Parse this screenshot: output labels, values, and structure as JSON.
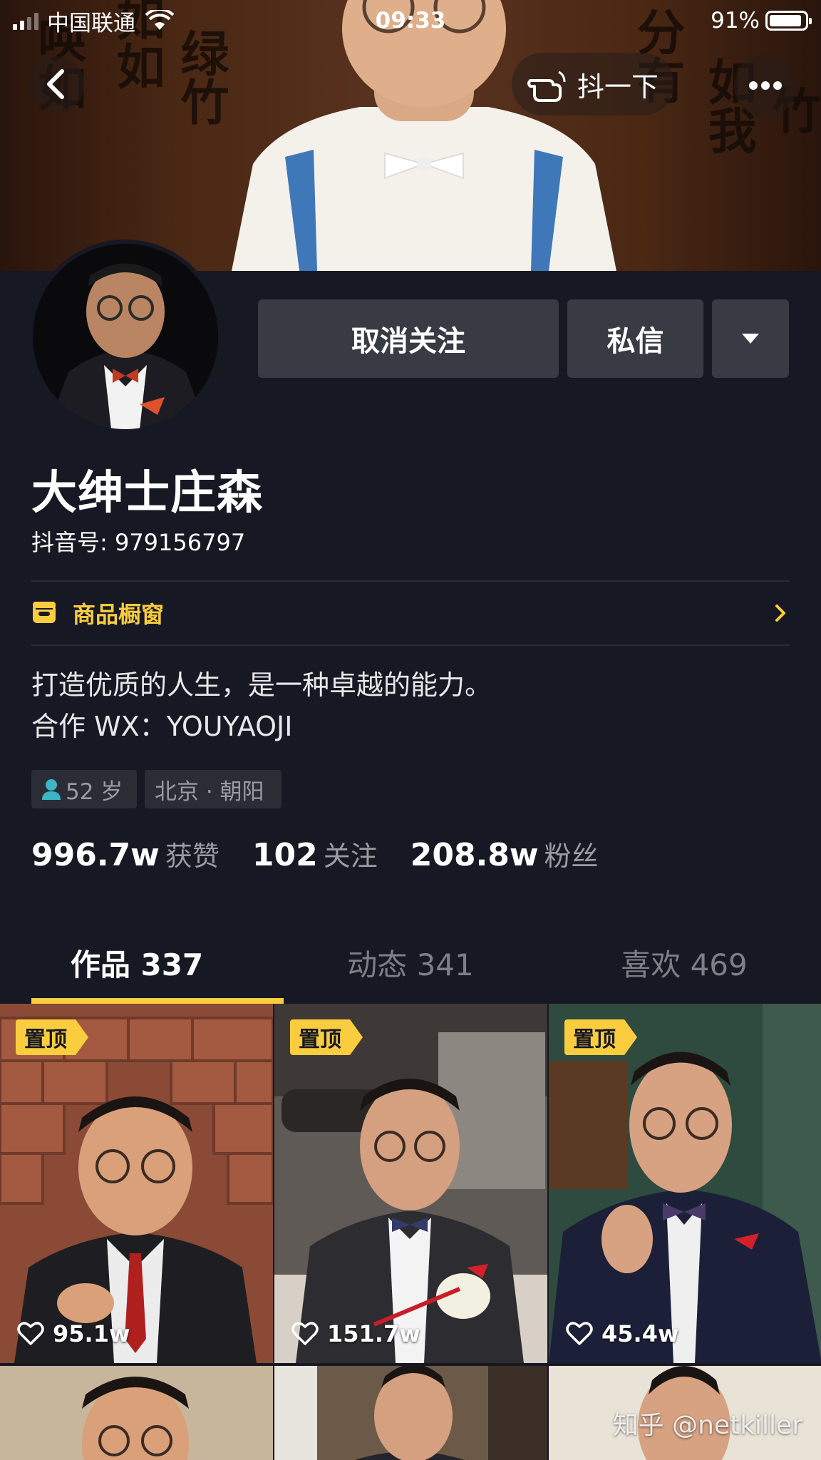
{
  "status_bar": {
    "carrier": "中国联通",
    "time": "09:33",
    "battery": "91%",
    "battery_level": 0.91
  },
  "header": {
    "shake_label": "抖一下"
  },
  "cover": {
    "calligraphy": [
      "如如",
      "绿竹",
      "唤如",
      "分有",
      "分",
      "绿",
      "如我",
      "竹"
    ]
  },
  "actions": {
    "unfollow_label": "取消关注",
    "message_label": "私信"
  },
  "profile": {
    "nickname": "大绅士庄森",
    "douyin_id": "抖音号: 979156797",
    "shop_label": "商品橱窗",
    "bio": "打造优质的人生，是一种卓越的能力。\n合作 WX：YOUYAOJI",
    "tags": {
      "age": "52 岁",
      "location": "北京 · 朝阳"
    },
    "stats": [
      {
        "value": "996.7w",
        "label": "获赞"
      },
      {
        "value": "102",
        "label": "关注"
      },
      {
        "value": "208.8w",
        "label": "粉丝"
      }
    ]
  },
  "tabs": [
    {
      "label": "作品 337",
      "active": true
    },
    {
      "label": "动态 341",
      "active": false
    },
    {
      "label": "喜欢 469",
      "active": false
    }
  ],
  "videos": [
    {
      "pinned_label": "置顶",
      "likes": "95.1w"
    },
    {
      "pinned_label": "置顶",
      "likes": "151.7w"
    },
    {
      "pinned_label": "置顶",
      "likes": "45.4w"
    }
  ],
  "watermark": "知乎 @netkiller",
  "colors": {
    "background": "#161823",
    "accent": "#facd3f",
    "button": "#393b44",
    "muted_text": "#9a9ba3"
  }
}
